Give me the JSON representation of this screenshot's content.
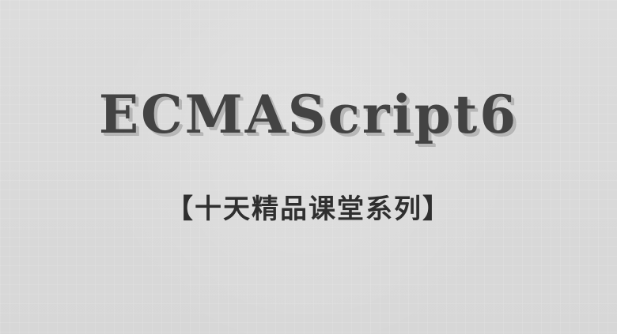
{
  "banner": {
    "title": "ECMAScript6",
    "subtitle": "【十天精品课堂系列】"
  }
}
